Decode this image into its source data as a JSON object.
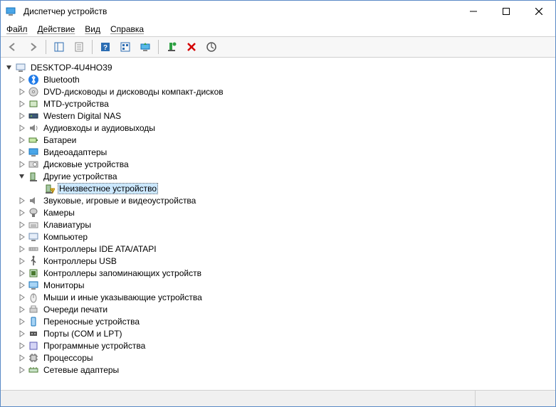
{
  "window": {
    "title": "Диспетчер устройств"
  },
  "menubar": {
    "file": "Файл",
    "action": "Действие",
    "view": "Вид",
    "help": "Справка"
  },
  "tree": {
    "root": "DESKTOP-4U4HO39",
    "nodes": [
      {
        "icon": "bluetooth",
        "label": "Bluetooth"
      },
      {
        "icon": "dvd",
        "label": "DVD-дисководы и дисководы компакт-дисков"
      },
      {
        "icon": "mtd",
        "label": "MTD-устройства"
      },
      {
        "icon": "nas",
        "label": "Western Digital NAS"
      },
      {
        "icon": "audio",
        "label": "Аудиовходы и аудиовыходы"
      },
      {
        "icon": "battery",
        "label": "Батареи"
      },
      {
        "icon": "display",
        "label": "Видеоадаптеры"
      },
      {
        "icon": "disk",
        "label": "Дисковые устройства"
      },
      {
        "icon": "other",
        "label": "Другие устройства",
        "expanded": true,
        "children": [
          {
            "icon": "unknown",
            "label": "Неизвестное устройство",
            "selected": true
          }
        ]
      },
      {
        "icon": "sound",
        "label": "Звуковые, игровые и видеоустройства"
      },
      {
        "icon": "camera",
        "label": "Камеры"
      },
      {
        "icon": "keyboard",
        "label": "Клавиатуры"
      },
      {
        "icon": "computer",
        "label": "Компьютер"
      },
      {
        "icon": "ide",
        "label": "Контроллеры IDE ATA/ATAPI"
      },
      {
        "icon": "usb",
        "label": "Контроллеры USB"
      },
      {
        "icon": "storage",
        "label": "Контроллеры запоминающих устройств"
      },
      {
        "icon": "monitor",
        "label": "Мониторы"
      },
      {
        "icon": "mouse",
        "label": "Мыши и иные указывающие устройства"
      },
      {
        "icon": "printq",
        "label": "Очереди печати"
      },
      {
        "icon": "portable",
        "label": "Переносные устройства"
      },
      {
        "icon": "ports",
        "label": "Порты (COM и LPT)"
      },
      {
        "icon": "software",
        "label": "Программные устройства"
      },
      {
        "icon": "cpu",
        "label": "Процессоры"
      },
      {
        "icon": "network",
        "label": "Сетевые адаптеры"
      }
    ]
  }
}
